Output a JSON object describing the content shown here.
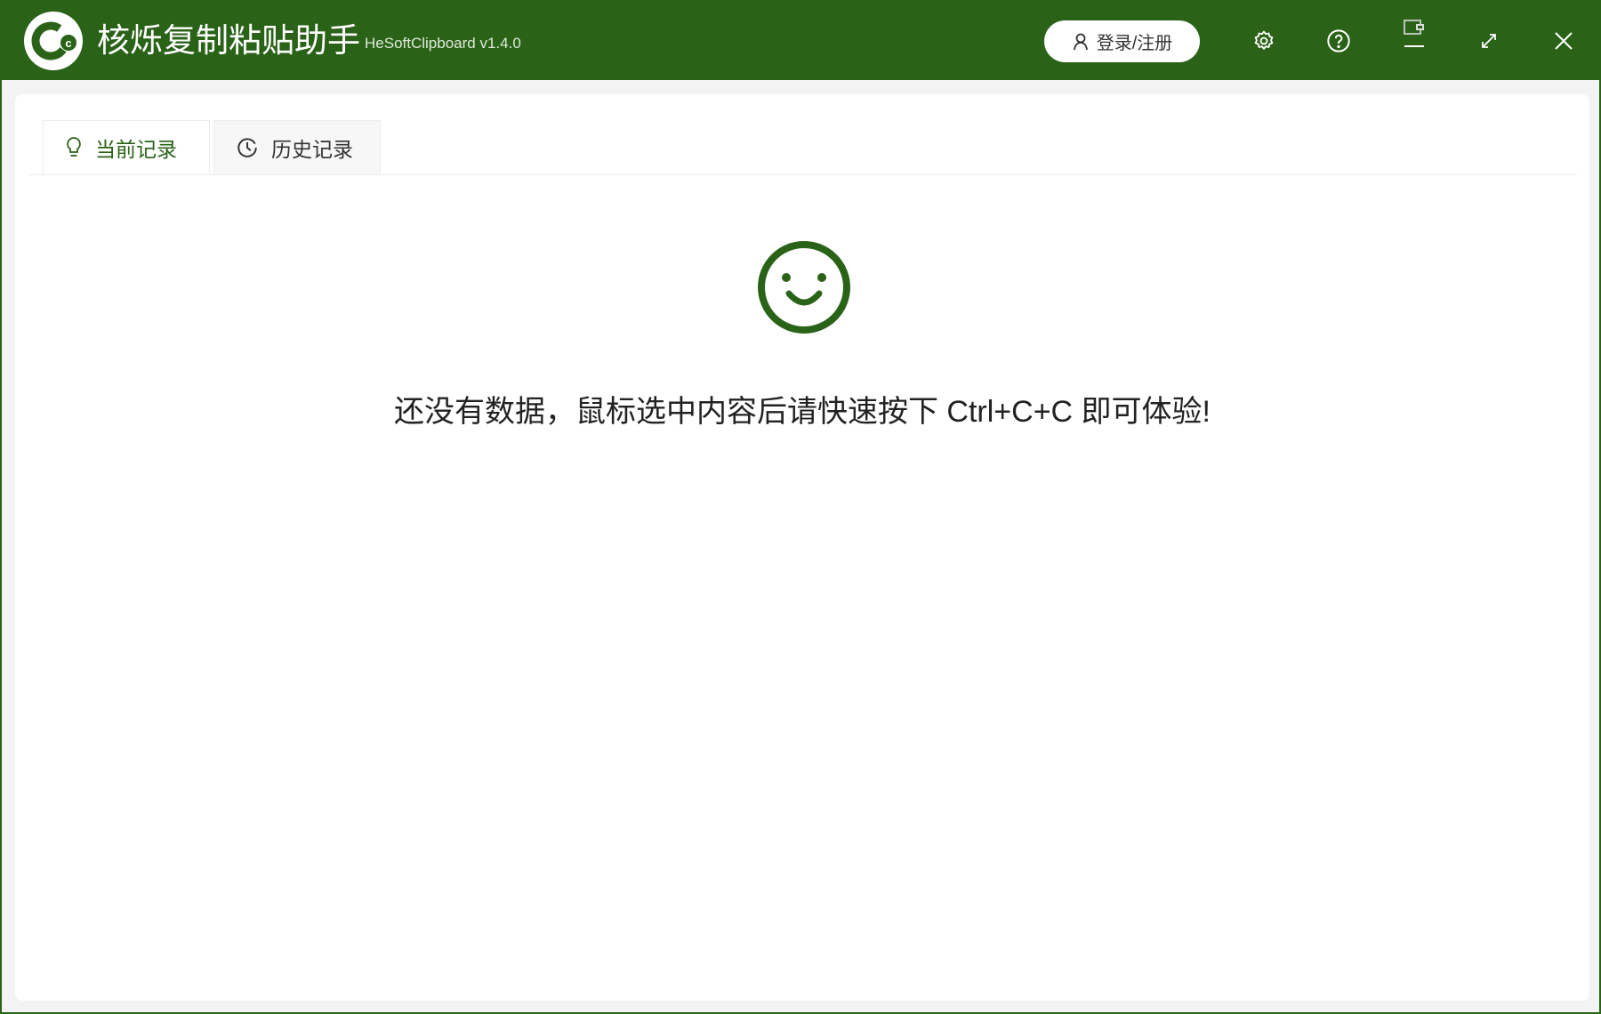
{
  "app": {
    "title": "核烁复制粘贴助手",
    "version": "HeSoftClipboard v1.4.0",
    "logo_text": "Cc"
  },
  "header": {
    "login_label": "登录/注册"
  },
  "tabs": [
    {
      "label": "当前记录",
      "icon": "lightbulb-icon",
      "active": true
    },
    {
      "label": "历史记录",
      "icon": "clock-icon",
      "active": false
    }
  ],
  "empty": {
    "icon": "smiley-icon",
    "message": "还没有数据，鼠标选中内容后请快速按下 Ctrl+C+C 即可体验!"
  },
  "colors": {
    "brand": "#2a6318"
  }
}
